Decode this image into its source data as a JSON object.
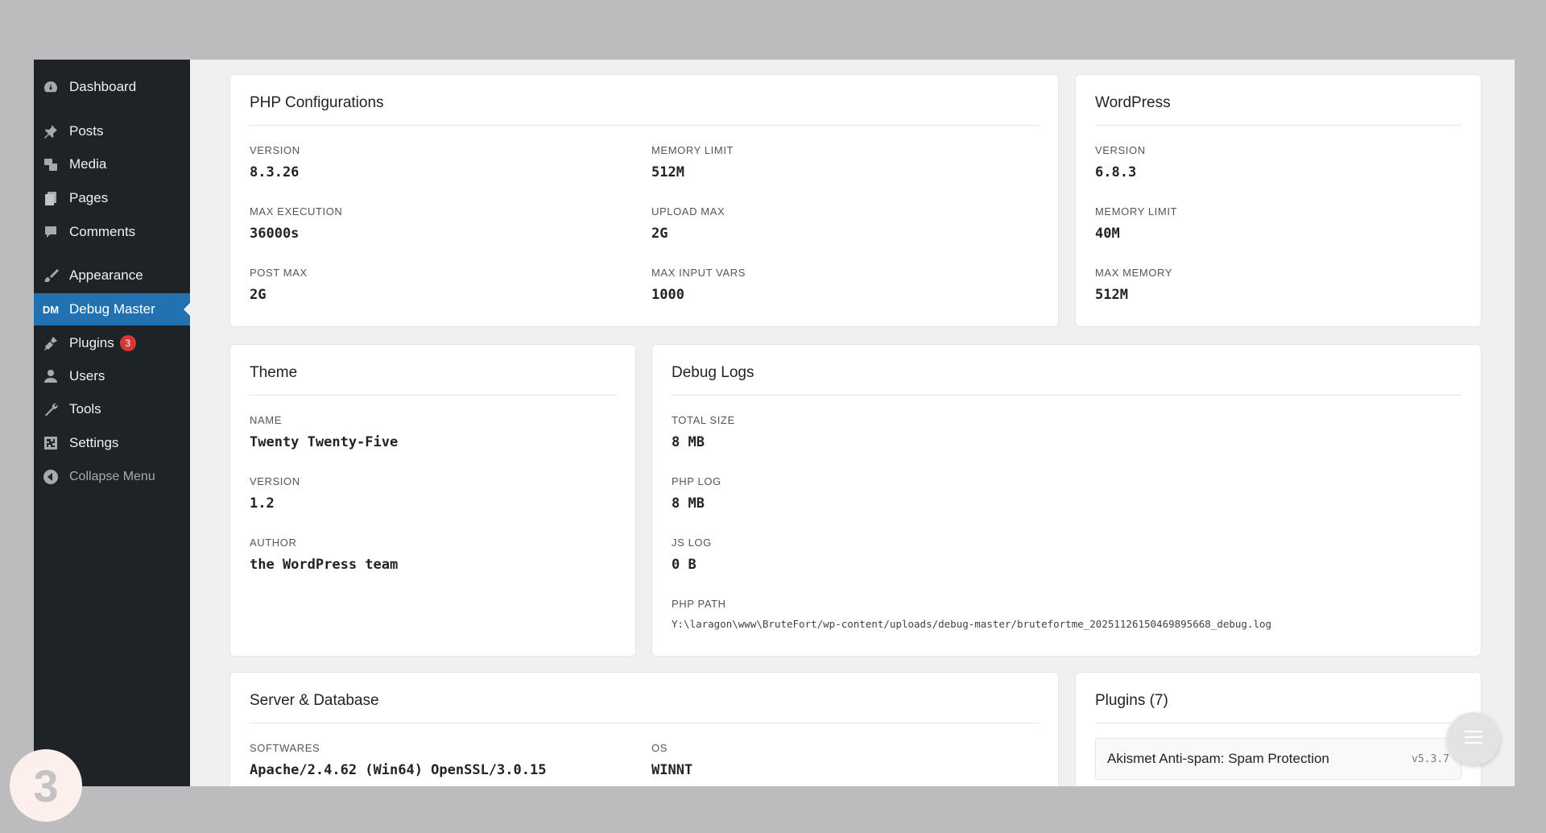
{
  "sidebar": {
    "items": [
      {
        "label": "Dashboard",
        "icon": "dashboard-icon"
      },
      {
        "label": "Posts",
        "icon": "pin-icon"
      },
      {
        "label": "Media",
        "icon": "media-icon"
      },
      {
        "label": "Pages",
        "icon": "pages-icon"
      },
      {
        "label": "Comments",
        "icon": "comment-icon"
      },
      {
        "label": "Appearance",
        "icon": "brush-icon"
      },
      {
        "label": "Debug Master",
        "icon_text": "DM",
        "active": true
      },
      {
        "label": "Plugins",
        "icon": "plugin-icon",
        "badge": "3"
      },
      {
        "label": "Users",
        "icon": "user-icon"
      },
      {
        "label": "Tools",
        "icon": "wrench-icon"
      },
      {
        "label": "Settings",
        "icon": "settings-icon"
      },
      {
        "label": "Collapse Menu",
        "icon": "collapse-icon"
      }
    ]
  },
  "php": {
    "title": "PHP Configurations",
    "fields": [
      {
        "label": "VERSION",
        "value": "8.3.26"
      },
      {
        "label": "MEMORY LIMIT",
        "value": "512M"
      },
      {
        "label": "MAX EXECUTION",
        "value": "36000s"
      },
      {
        "label": "UPLOAD MAX",
        "value": "2G"
      },
      {
        "label": "POST MAX",
        "value": "2G"
      },
      {
        "label": "MAX INPUT VARS",
        "value": "1000"
      }
    ]
  },
  "wordpress": {
    "title": "WordPress",
    "fields": [
      {
        "label": "VERSION",
        "value": "6.8.3"
      },
      {
        "label": "MEMORY LIMIT",
        "value": "40M"
      },
      {
        "label": "MAX MEMORY",
        "value": "512M"
      }
    ]
  },
  "theme": {
    "title": "Theme",
    "fields": [
      {
        "label": "NAME",
        "value": "Twenty Twenty-Five"
      },
      {
        "label": "VERSION",
        "value": "1.2"
      },
      {
        "label": "AUTHOR",
        "value": "the WordPress team"
      }
    ]
  },
  "debug_logs": {
    "title": "Debug Logs",
    "fields": [
      {
        "label": "TOTAL SIZE",
        "value": "8 MB"
      },
      {
        "label": "PHP LOG",
        "value": "8 MB"
      },
      {
        "label": "JS LOG",
        "value": "0 B"
      },
      {
        "label": "PHP PATH",
        "value": "Y:\\laragon\\www\\BruteFort/wp-content/uploads/debug-master/brutefortme_20251126150469895668_debug.log"
      }
    ]
  },
  "server": {
    "title": "Server & Database",
    "fields": [
      {
        "label": "SOFTWARES",
        "value": "Apache/2.4.62 (Win64) OpenSSL/3.0.15"
      },
      {
        "label": "OS",
        "value": "WINNT"
      }
    ]
  },
  "plugins": {
    "title": "Plugins (7)",
    "items": [
      {
        "name": "Akismet Anti-spam: Spam Protection",
        "version": "v5.3.7"
      }
    ]
  },
  "step_badge": "3",
  "colors": {
    "sidebar_bg": "#1d2327",
    "active": "#2271b1",
    "badge": "#d63638"
  }
}
